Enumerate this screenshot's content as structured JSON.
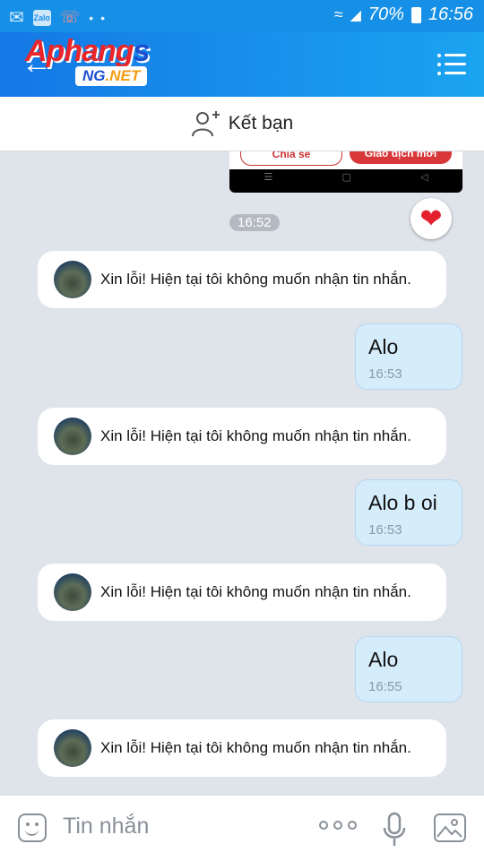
{
  "status_bar": {
    "zalo_label": "Zalo",
    "dots": "• •",
    "battery_percent": "70%",
    "time": "16:56"
  },
  "header": {
    "logo_main": "Aphang",
    "logo_s": "s",
    "logo_badge_left": "NG",
    "logo_badge_right": ".NET"
  },
  "friend_bar": {
    "label": "Kết bạn"
  },
  "shared_card": {
    "share_label": "Chia sẻ",
    "new_deal_label": "Giao dịch mới",
    "nav_glyphs": [
      "☰",
      "▢",
      "◁"
    ]
  },
  "reaction": {
    "icon": "heart-icon",
    "glyph": "❤"
  },
  "timestamp_pill": "16:52",
  "messages": [
    {
      "dir": "in",
      "text": "Xin lỗi! Hiện tại tôi không muốn nhận tin nhắn."
    },
    {
      "dir": "out",
      "text": "Alo",
      "time": "16:53"
    },
    {
      "dir": "in",
      "text": "Xin lỗi! Hiện tại tôi không muốn nhận tin nhắn."
    },
    {
      "dir": "out",
      "text": "Alo b oi",
      "time": "16:53"
    },
    {
      "dir": "in",
      "text": "Xin lỗi! Hiện tại tôi không muốn nhận tin nhắn."
    },
    {
      "dir": "out",
      "text": "Alo",
      "time": "16:55"
    },
    {
      "dir": "in",
      "text": "Xin lỗi! Hiện tại tôi không muốn nhận tin nhắn."
    }
  ],
  "input_bar": {
    "placeholder": "Tin nhắn"
  },
  "colors": {
    "header": "#1690e6",
    "outgoing_bubble": "#d5ecfb",
    "chat_background": "#dfe3ea"
  }
}
